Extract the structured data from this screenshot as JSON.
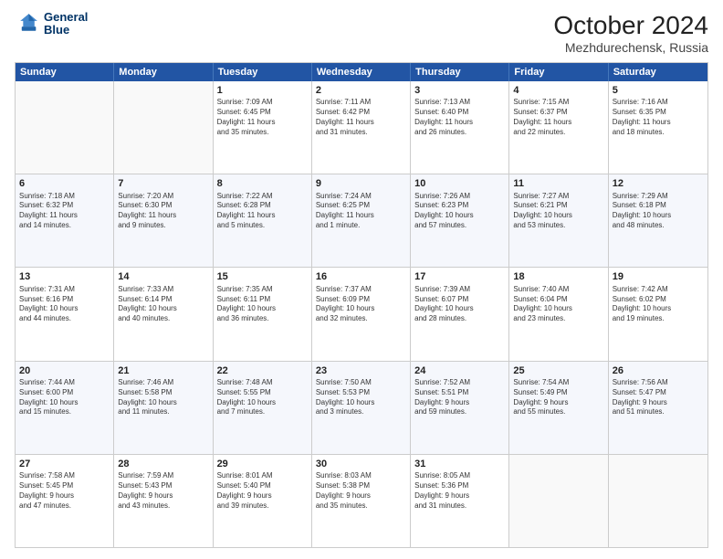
{
  "logo": {
    "line1": "General",
    "line2": "Blue"
  },
  "title": "October 2024",
  "subtitle": "Mezhdurechensk, Russia",
  "days": [
    "Sunday",
    "Monday",
    "Tuesday",
    "Wednesday",
    "Thursday",
    "Friday",
    "Saturday"
  ],
  "rows": [
    [
      {
        "day": "",
        "info": ""
      },
      {
        "day": "",
        "info": ""
      },
      {
        "day": "1",
        "info": "Sunrise: 7:09 AM\nSunset: 6:45 PM\nDaylight: 11 hours\nand 35 minutes."
      },
      {
        "day": "2",
        "info": "Sunrise: 7:11 AM\nSunset: 6:42 PM\nDaylight: 11 hours\nand 31 minutes."
      },
      {
        "day": "3",
        "info": "Sunrise: 7:13 AM\nSunset: 6:40 PM\nDaylight: 11 hours\nand 26 minutes."
      },
      {
        "day": "4",
        "info": "Sunrise: 7:15 AM\nSunset: 6:37 PM\nDaylight: 11 hours\nand 22 minutes."
      },
      {
        "day": "5",
        "info": "Sunrise: 7:16 AM\nSunset: 6:35 PM\nDaylight: 11 hours\nand 18 minutes."
      }
    ],
    [
      {
        "day": "6",
        "info": "Sunrise: 7:18 AM\nSunset: 6:32 PM\nDaylight: 11 hours\nand 14 minutes."
      },
      {
        "day": "7",
        "info": "Sunrise: 7:20 AM\nSunset: 6:30 PM\nDaylight: 11 hours\nand 9 minutes."
      },
      {
        "day": "8",
        "info": "Sunrise: 7:22 AM\nSunset: 6:28 PM\nDaylight: 11 hours\nand 5 minutes."
      },
      {
        "day": "9",
        "info": "Sunrise: 7:24 AM\nSunset: 6:25 PM\nDaylight: 11 hours\nand 1 minute."
      },
      {
        "day": "10",
        "info": "Sunrise: 7:26 AM\nSunset: 6:23 PM\nDaylight: 10 hours\nand 57 minutes."
      },
      {
        "day": "11",
        "info": "Sunrise: 7:27 AM\nSunset: 6:21 PM\nDaylight: 10 hours\nand 53 minutes."
      },
      {
        "day": "12",
        "info": "Sunrise: 7:29 AM\nSunset: 6:18 PM\nDaylight: 10 hours\nand 48 minutes."
      }
    ],
    [
      {
        "day": "13",
        "info": "Sunrise: 7:31 AM\nSunset: 6:16 PM\nDaylight: 10 hours\nand 44 minutes."
      },
      {
        "day": "14",
        "info": "Sunrise: 7:33 AM\nSunset: 6:14 PM\nDaylight: 10 hours\nand 40 minutes."
      },
      {
        "day": "15",
        "info": "Sunrise: 7:35 AM\nSunset: 6:11 PM\nDaylight: 10 hours\nand 36 minutes."
      },
      {
        "day": "16",
        "info": "Sunrise: 7:37 AM\nSunset: 6:09 PM\nDaylight: 10 hours\nand 32 minutes."
      },
      {
        "day": "17",
        "info": "Sunrise: 7:39 AM\nSunset: 6:07 PM\nDaylight: 10 hours\nand 28 minutes."
      },
      {
        "day": "18",
        "info": "Sunrise: 7:40 AM\nSunset: 6:04 PM\nDaylight: 10 hours\nand 23 minutes."
      },
      {
        "day": "19",
        "info": "Sunrise: 7:42 AM\nSunset: 6:02 PM\nDaylight: 10 hours\nand 19 minutes."
      }
    ],
    [
      {
        "day": "20",
        "info": "Sunrise: 7:44 AM\nSunset: 6:00 PM\nDaylight: 10 hours\nand 15 minutes."
      },
      {
        "day": "21",
        "info": "Sunrise: 7:46 AM\nSunset: 5:58 PM\nDaylight: 10 hours\nand 11 minutes."
      },
      {
        "day": "22",
        "info": "Sunrise: 7:48 AM\nSunset: 5:55 PM\nDaylight: 10 hours\nand 7 minutes."
      },
      {
        "day": "23",
        "info": "Sunrise: 7:50 AM\nSunset: 5:53 PM\nDaylight: 10 hours\nand 3 minutes."
      },
      {
        "day": "24",
        "info": "Sunrise: 7:52 AM\nSunset: 5:51 PM\nDaylight: 9 hours\nand 59 minutes."
      },
      {
        "day": "25",
        "info": "Sunrise: 7:54 AM\nSunset: 5:49 PM\nDaylight: 9 hours\nand 55 minutes."
      },
      {
        "day": "26",
        "info": "Sunrise: 7:56 AM\nSunset: 5:47 PM\nDaylight: 9 hours\nand 51 minutes."
      }
    ],
    [
      {
        "day": "27",
        "info": "Sunrise: 7:58 AM\nSunset: 5:45 PM\nDaylight: 9 hours\nand 47 minutes."
      },
      {
        "day": "28",
        "info": "Sunrise: 7:59 AM\nSunset: 5:43 PM\nDaylight: 9 hours\nand 43 minutes."
      },
      {
        "day": "29",
        "info": "Sunrise: 8:01 AM\nSunset: 5:40 PM\nDaylight: 9 hours\nand 39 minutes."
      },
      {
        "day": "30",
        "info": "Sunrise: 8:03 AM\nSunset: 5:38 PM\nDaylight: 9 hours\nand 35 minutes."
      },
      {
        "day": "31",
        "info": "Sunrise: 8:05 AM\nSunset: 5:36 PM\nDaylight: 9 hours\nand 31 minutes."
      },
      {
        "day": "",
        "info": ""
      },
      {
        "day": "",
        "info": ""
      }
    ]
  ]
}
